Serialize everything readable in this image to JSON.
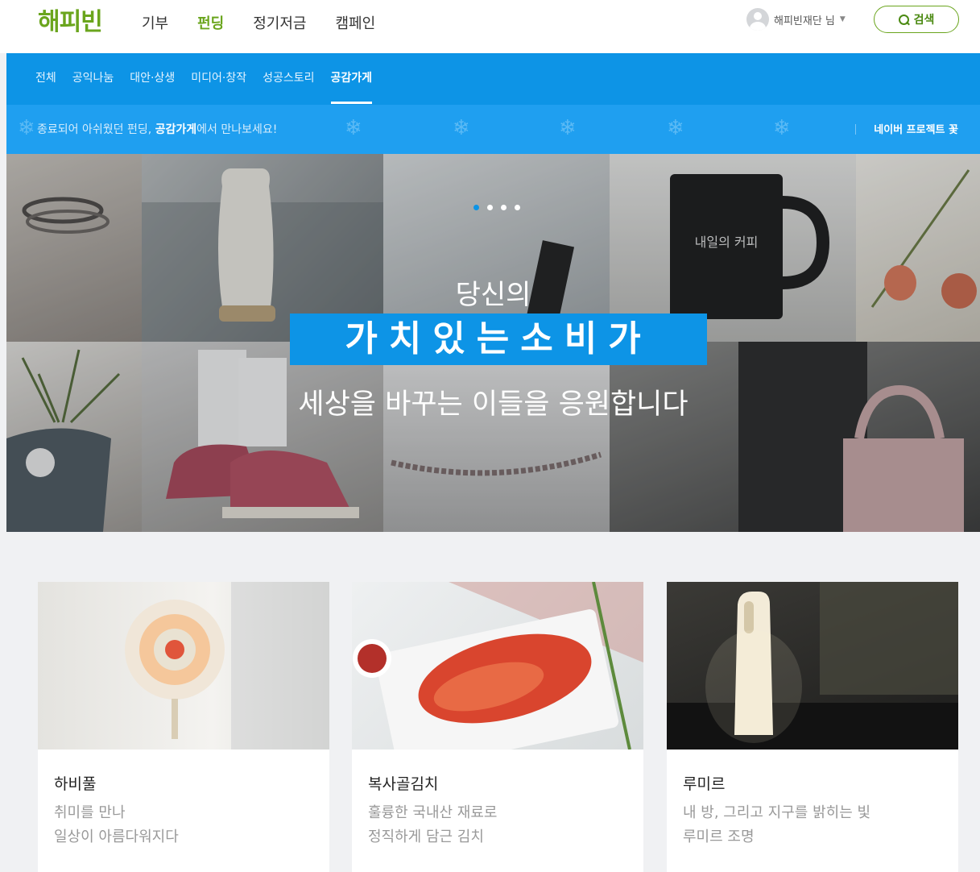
{
  "header": {
    "logo": "해피빈",
    "nav": [
      {
        "label": "기부",
        "active": false
      },
      {
        "label": "펀딩",
        "active": true
      },
      {
        "label": "정기저금",
        "active": false
      },
      {
        "label": "캠페인",
        "active": false
      }
    ],
    "user_name": "해피빈재단 님",
    "search_label": "검색"
  },
  "subnav": {
    "items": [
      {
        "label": "전체",
        "active": false
      },
      {
        "label": "공익나눔",
        "active": false
      },
      {
        "label": "대안·상생",
        "active": false
      },
      {
        "label": "미디어·창작",
        "active": false
      },
      {
        "label": "성공스토리",
        "active": false
      },
      {
        "label": "공감가게",
        "active": true
      }
    ]
  },
  "promo": {
    "text_before": "종료되어 아쉬웠던 펀딩, ",
    "text_bold": "공감가게",
    "text_after": "에서 만나보세요!",
    "right_link": "네이버 프로젝트 꽃"
  },
  "hero": {
    "line1": "당신의",
    "line2": "가치있는소비가",
    "line3": "세상을 바꾸는 이들을 응원합니다",
    "slide_count": 4,
    "active_slide": 1,
    "mug_text": "내일의 커피"
  },
  "cards": [
    {
      "name": "하비풀",
      "desc_line1": "취미를 만나",
      "desc_line2": "일상이 아름다워지다"
    },
    {
      "name": "복사골김치",
      "desc_line1": "훌륭한 국내산 재료로",
      "desc_line2": "정직하게 담근 김치"
    },
    {
      "name": "루미르",
      "desc_line1": "내 방, 그리고 지구를 밝히는 빛",
      "desc_line2": "루미르 조명"
    }
  ],
  "colors": {
    "brand_green": "#6aa51d",
    "accent_blue": "#0d94e6"
  }
}
